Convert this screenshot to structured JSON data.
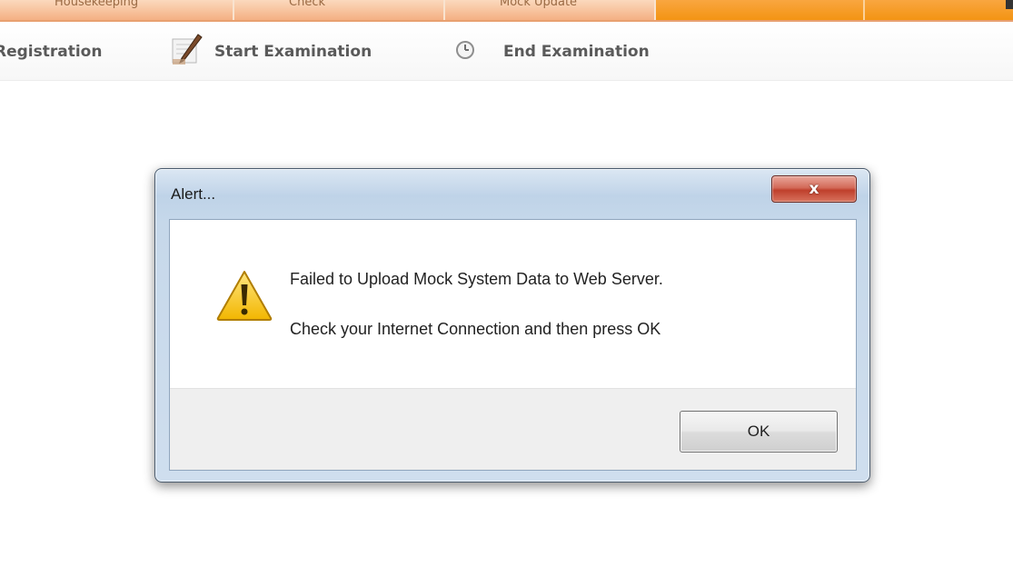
{
  "tabs": [
    {
      "label": "Housekeeping",
      "active": false
    },
    {
      "label": "Check",
      "active": false
    },
    {
      "label": "Mock Update",
      "active": false
    },
    {
      "label": "",
      "active": true
    },
    {
      "label": "",
      "active": true
    }
  ],
  "toolbar": {
    "items": [
      {
        "label": "Registration",
        "icon": "registration-icon"
      },
      {
        "label": "Start Examination",
        "icon": "pen-paper-icon"
      },
      {
        "label": "End Examination",
        "icon": "clock-icon"
      }
    ]
  },
  "dialog": {
    "title": "Alert...",
    "close_label": "x",
    "icon": "warning-icon",
    "message_line1": "Failed to Upload Mock System Data to Web Server.",
    "message_line2": "Check your Internet Connection and then press OK",
    "ok_label": "OK"
  },
  "colors": {
    "tab_orange": "#f39413",
    "tab_peach": "#f6b98f",
    "close_red": "#c8472f",
    "title_bar_blue": "#bfd3e8"
  }
}
